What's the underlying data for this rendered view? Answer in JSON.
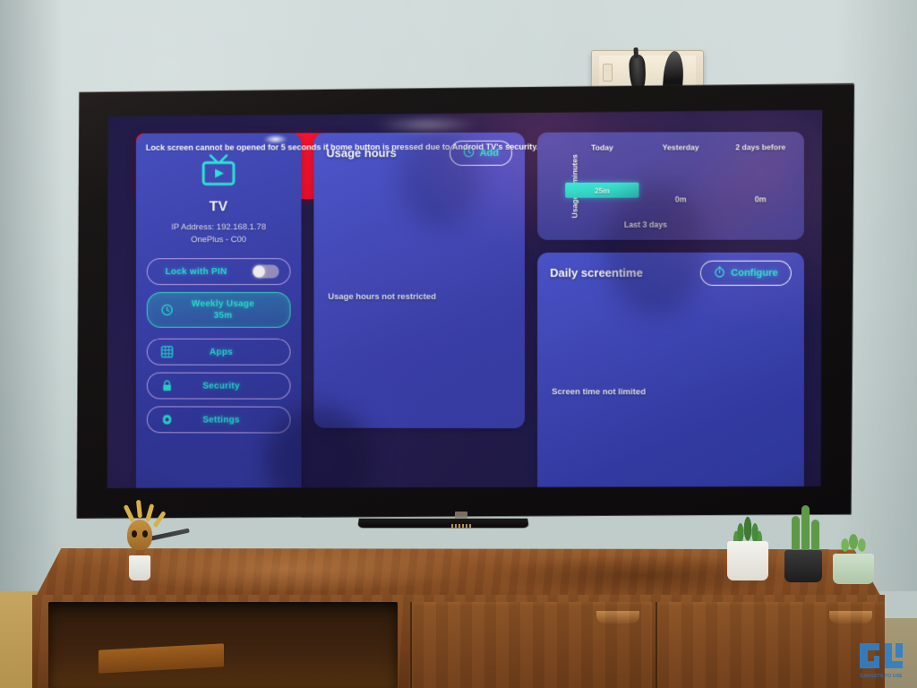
{
  "scene": {
    "watermark_text": "GADGETS TO USE",
    "socket_label": "wall-power-socket"
  },
  "device_card": {
    "icon": "tv-icon",
    "title": "TV",
    "ip_line": "IP Address: 192.168.1.78",
    "model_line": "OnePlus - C00",
    "lock_pin": {
      "label": "Lock with PIN",
      "toggle_state": "off",
      "icon": "toggle-switch-icon"
    },
    "weekly_usage": {
      "icon": "clock-icon",
      "label": "Weekly Usage",
      "value": "35m"
    },
    "menu": [
      {
        "icon": "grid-apps-icon",
        "label": "Apps"
      },
      {
        "icon": "lock-icon",
        "label": "Security"
      },
      {
        "icon": "gear-icon",
        "label": "Settings"
      }
    ]
  },
  "usage_hours_card": {
    "title": "Usage hours",
    "add_button": {
      "icon": "clock-icon",
      "label": "Add"
    },
    "status": "Usage hours not restricted"
  },
  "warning_card": {
    "text": "Lock screen cannot be opened for 5 seconds if home button is pressed due to Android TV's security. So there may be a slight delay to lock."
  },
  "screentime_card": {
    "title": "Daily screentime",
    "configure_button": {
      "icon": "stopwatch-icon",
      "label": "Configure"
    },
    "status": "Screen time not limited"
  },
  "chart_data": {
    "type": "bar",
    "title": "",
    "categories": [
      "Today",
      "Yesterday",
      "2 days before"
    ],
    "values": [
      25,
      0,
      0
    ],
    "value_labels": [
      "25m",
      "0m",
      "0m"
    ],
    "xlabel": "Last 3 days",
    "ylabel": "Usage in minutes",
    "ylim": [
      0,
      30
    ],
    "grid": false,
    "legend": "none",
    "bar_color": "#18e8d4"
  },
  "colors": {
    "accent_cyan": "#1de9d6",
    "card_blue": "#3a44c0",
    "warning_red": "#ff1b2d",
    "pill_border": "#b9a5f0",
    "screen_bg": "#1d1840"
  }
}
